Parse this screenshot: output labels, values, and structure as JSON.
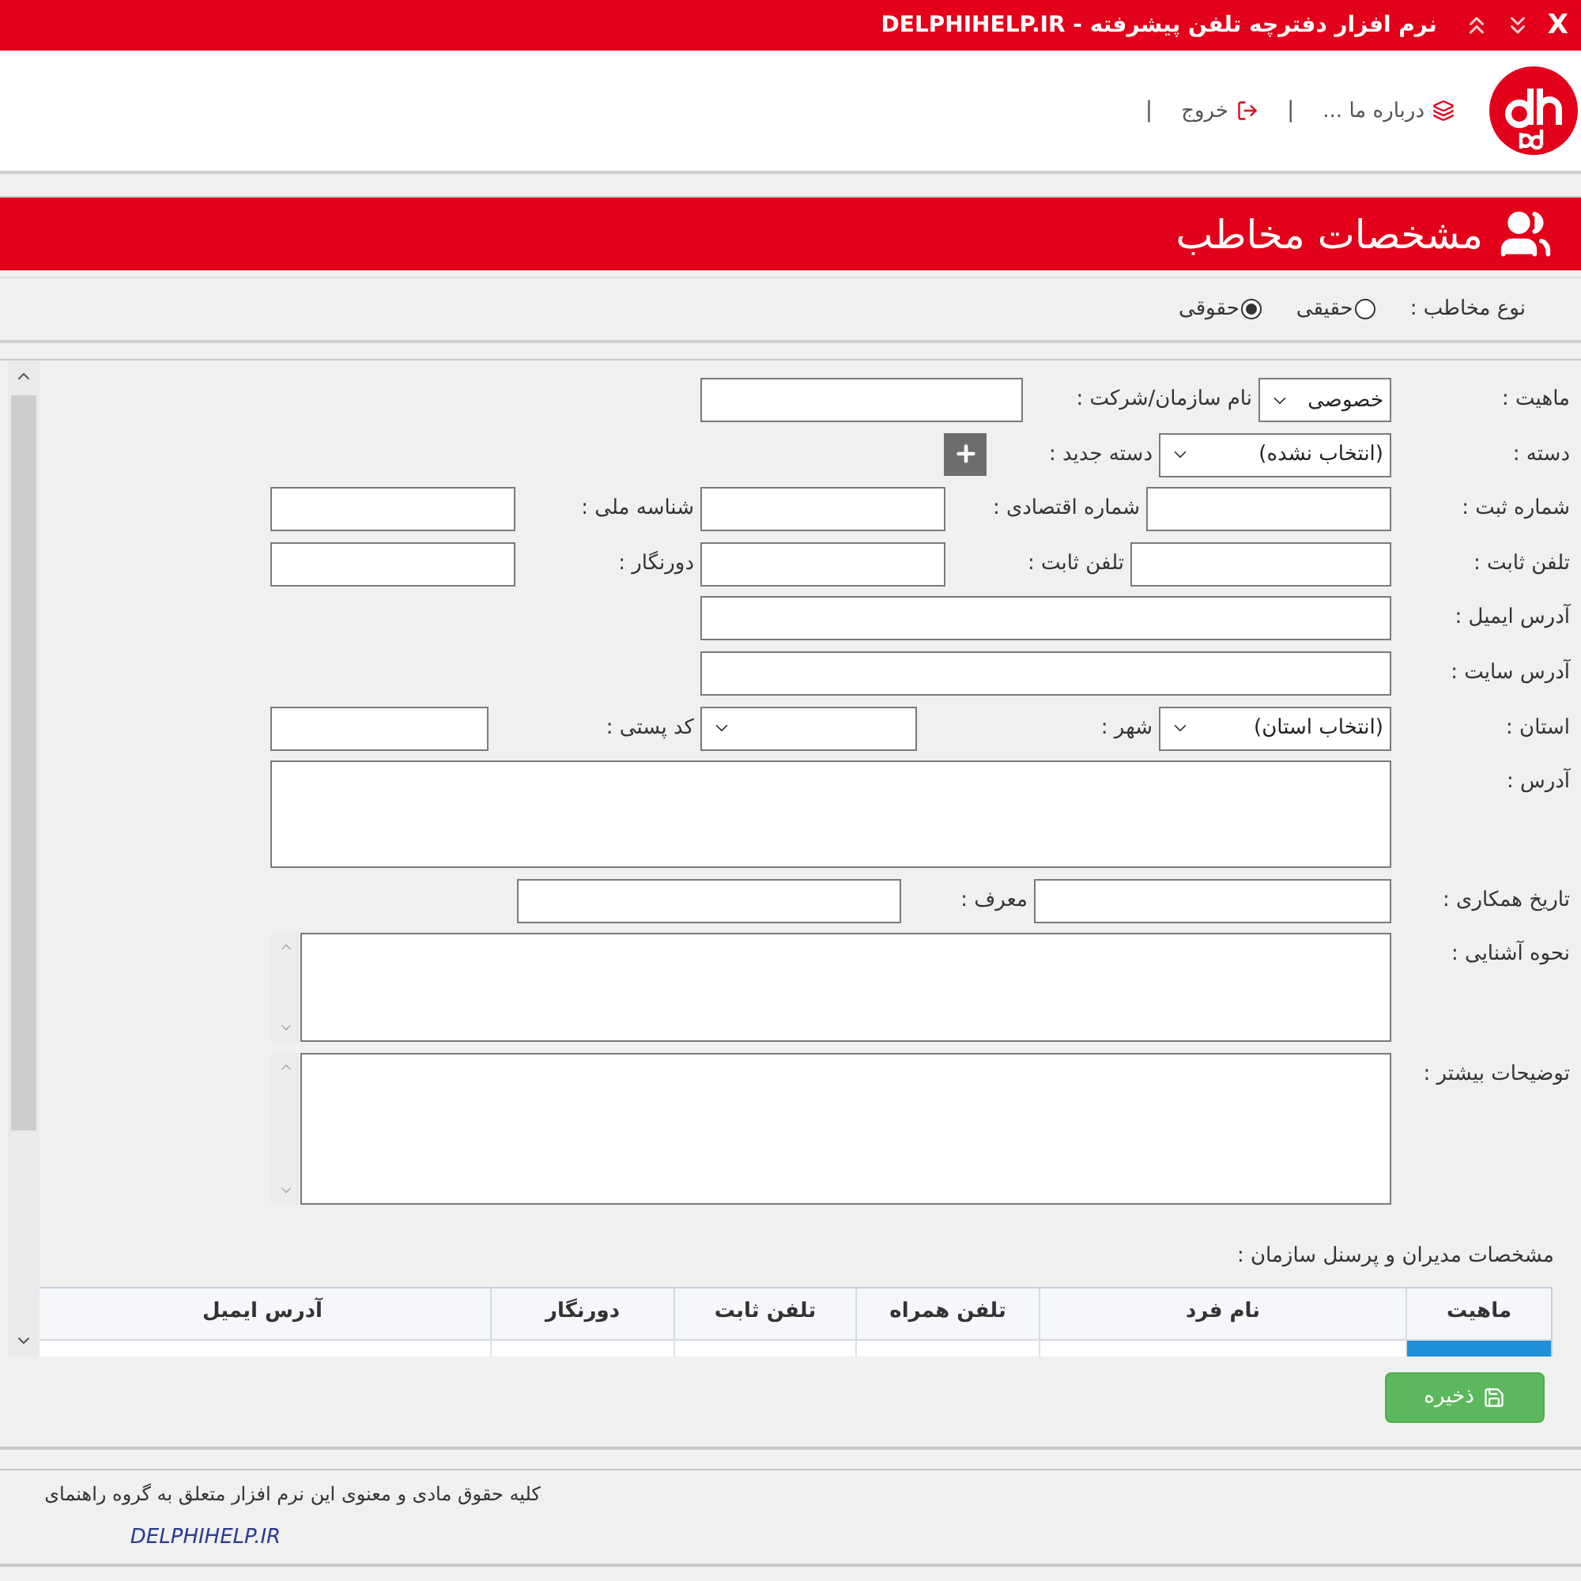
{
  "title_bar": {
    "title": "نرم افزار دفترچه تلفن پیشرفته - DELPHIHELP.IR",
    "close": "X"
  },
  "header": {
    "menu": [
      {
        "kind": "about",
        "label": "درباره ما ..."
      },
      {
        "kind": "separator",
        "label": "|"
      },
      {
        "kind": "exit",
        "label": "خروج"
      },
      {
        "kind": "separator",
        "label": "|"
      }
    ]
  },
  "banner": {
    "title": "مشخصات مخاطب"
  },
  "contact_type": {
    "label": "نوع مخاطب :",
    "options": [
      {
        "label": "حقیقی",
        "selected": false
      },
      {
        "label": "حقوقی",
        "selected": true
      }
    ]
  },
  "form": {
    "rows": [
      [
        {
          "kind": "label",
          "text": "ماهیت :"
        },
        {
          "kind": "select",
          "value": "خصوصی"
        },
        {
          "kind": "label",
          "text": "نام سازمان/شرکت :"
        },
        {
          "kind": "input"
        }
      ],
      [
        {
          "kind": "label",
          "text": "دسته :"
        },
        {
          "kind": "select",
          "value": "(انتخاب نشده)"
        },
        {
          "kind": "label",
          "text": "دسته جدید :"
        },
        {
          "kind": "add_button"
        }
      ],
      [
        {
          "kind": "label",
          "text": "شماره ثبت :"
        },
        {
          "kind": "input"
        },
        {
          "kind": "label",
          "text": "شماره اقتصادی :"
        },
        {
          "kind": "input"
        },
        {
          "kind": "label",
          "text": "شناسه ملی :"
        },
        {
          "kind": "input"
        }
      ],
      [
        {
          "kind": "label",
          "text": "تلفن ثابت :"
        },
        {
          "kind": "input"
        },
        {
          "kind": "label",
          "text": "تلفن ثابت :"
        },
        {
          "kind": "input"
        },
        {
          "kind": "label",
          "text": "دورنگار :"
        },
        {
          "kind": "input"
        }
      ],
      [
        {
          "kind": "label",
          "text": "آدرس ایمیل :"
        },
        {
          "kind": "input"
        }
      ],
      [
        {
          "kind": "label",
          "text": "آدرس سایت :"
        },
        {
          "kind": "input"
        }
      ],
      [
        {
          "kind": "label",
          "text": "استان :"
        },
        {
          "kind": "select",
          "value": "(انتخاب استان)"
        },
        {
          "kind": "label",
          "text": "شهر :"
        },
        {
          "kind": "select"
        },
        {
          "kind": "label",
          "text": "کد پستی :"
        },
        {
          "kind": "input"
        }
      ],
      [
        {
          "kind": "label",
          "text": "آدرس :"
        },
        {
          "kind": "textarea"
        }
      ],
      [
        {
          "kind": "label",
          "text": "تاریخ همکاری :"
        },
        {
          "kind": "input"
        },
        {
          "kind": "label",
          "text": "معرف :"
        },
        {
          "kind": "input"
        }
      ],
      [
        {
          "kind": "label",
          "text": "نحوه آشنایی :"
        },
        {
          "kind": "memo"
        }
      ],
      [
        {
          "kind": "label",
          "text": "توضیحات بیشتر :"
        },
        {
          "kind": "memo"
        }
      ]
    ]
  },
  "staff": {
    "title": "مشخصات مدیران و پرسنل سازمان :",
    "columns": [
      "ماهیت",
      "نام فرد",
      "تلفن همراه",
      "تلفن ثابت",
      "دورنگار",
      "آدرس ایمیل"
    ],
    "rows": [
      {
        "selected": true
      }
    ]
  },
  "save_button": {
    "label": "ذخیره"
  },
  "footer": {
    "copyright": "کلیه حقوق مادی و معنوی این نرم افزار متعلق به گروه راهنمای",
    "site": "DELPHIHELP.IR"
  }
}
